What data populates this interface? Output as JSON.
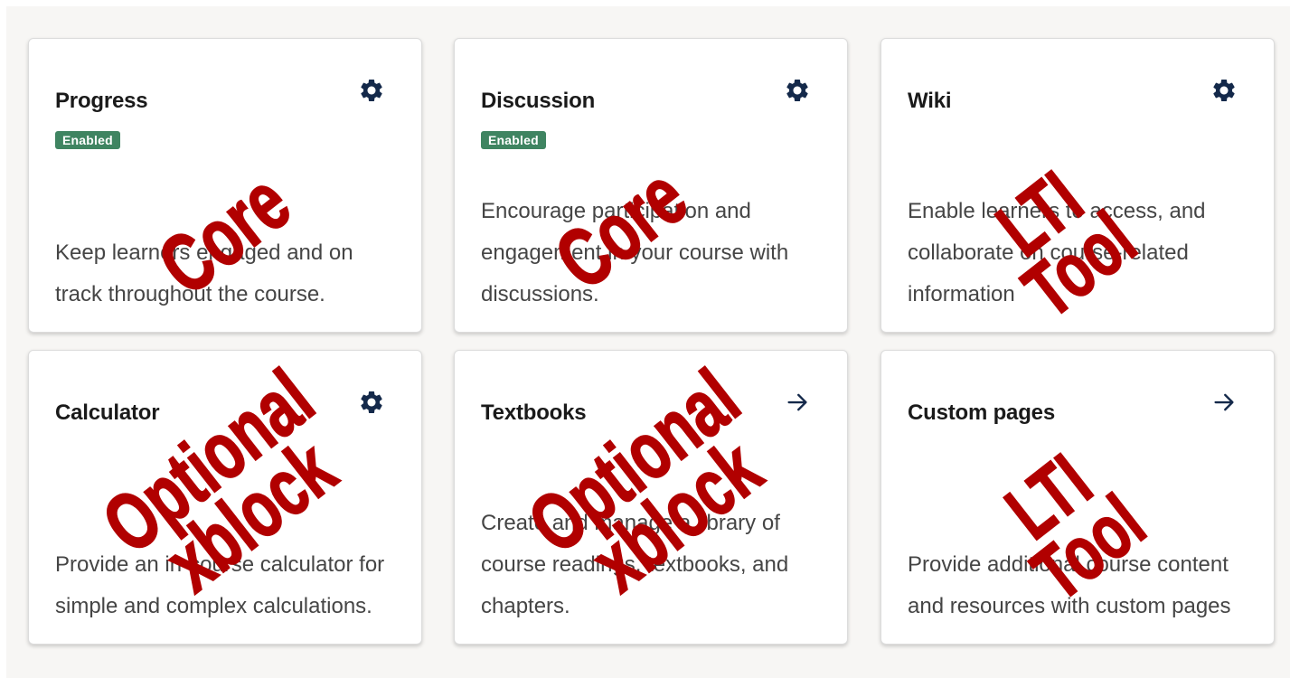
{
  "theme": {
    "badge_color": "#3f8461",
    "icon_color": "#14294a",
    "stamp_color": "#b10000"
  },
  "cards": [
    {
      "title": "Progress",
      "badge": "Enabled",
      "description": "Keep learners engaged and on track throughout the course.",
      "action_icon": "gear-icon",
      "stamp": [
        "Core"
      ]
    },
    {
      "title": "Discussion",
      "badge": "Enabled",
      "description": "Encourage participation and engagement in your course with discussions.",
      "action_icon": "gear-icon",
      "stamp": [
        "Core"
      ]
    },
    {
      "title": "Wiki",
      "badge": "",
      "description": "Enable learners to access, and collaborate on course-related information",
      "action_icon": "gear-icon",
      "stamp": [
        "LTI",
        "Tool"
      ]
    },
    {
      "title": "Calculator",
      "badge": "",
      "description": "Provide an in-course calculator for simple and complex calculations.",
      "action_icon": "gear-icon",
      "stamp": [
        "Optional",
        "xblock"
      ]
    },
    {
      "title": "Textbooks",
      "badge": "",
      "description": "Create and manage a library of course readings, textbooks, and chapters.",
      "action_icon": "arrow-right-icon",
      "stamp": [
        "Optional",
        "xblock"
      ]
    },
    {
      "title": "Custom pages",
      "badge": "",
      "description": "Provide additional course content and resources with custom pages",
      "action_icon": "arrow-right-icon",
      "stamp": [
        "LTI",
        "Tool"
      ]
    }
  ]
}
